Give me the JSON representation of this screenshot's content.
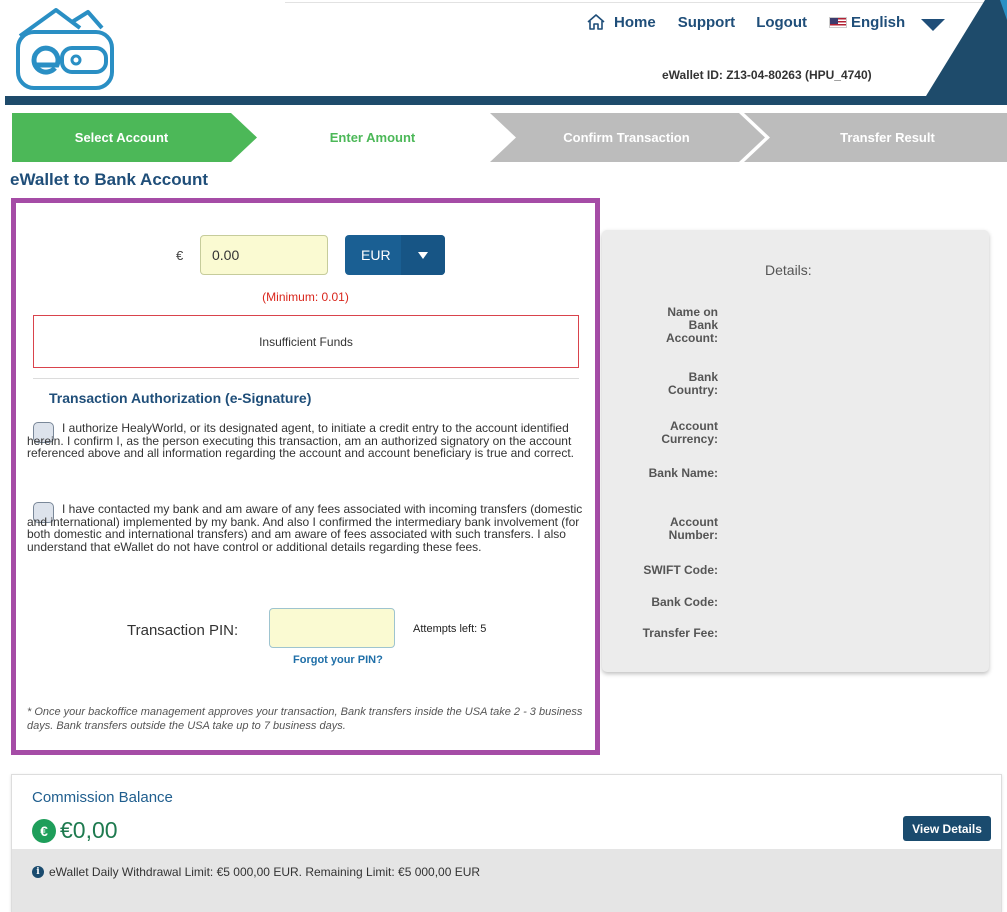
{
  "header": {
    "nav": {
      "home": "Home",
      "support": "Support",
      "logout": "Logout",
      "language": "English"
    },
    "wallet_id": "eWallet ID: Z13-04-80263 (HPU_4740)"
  },
  "steps": [
    {
      "label": "Select Account",
      "state": "complete"
    },
    {
      "label": "Enter Amount",
      "state": "current"
    },
    {
      "label": "Confirm Transaction",
      "state": "pending"
    },
    {
      "label": "Transfer Result",
      "state": "pending"
    }
  ],
  "page_title": "eWallet to Bank Account",
  "form": {
    "currency_symbol": "€",
    "amount_value": "0.00",
    "currency": "EUR",
    "minimum": "(Minimum: 0.01)",
    "error": "Insufficient Funds",
    "auth_title": "Transaction Authorization (e-Signature)",
    "consent1": "I authorize HealyWorld, or its designated agent, to initiate a credit entry to the account identified herein. I confirm I, as the person executing this transaction, am an authorized signatory on the account referenced above and all information regarding the account and account beneficiary is true and correct.",
    "consent2": "I have contacted my bank and am aware of any fees associated with incoming transfers (domestic and international) implemented by my bank. And also I confirmed the intermediary bank involvement (for both domestic and international transfers) and am aware of fees associated with such transfers. I also understand that eWallet do not have control or additional details regarding these fees.",
    "pin_label": "Transaction PIN:",
    "pin_value": "",
    "attempts": "Attempts left: 5",
    "forgot_pin": "Forgot your PIN?",
    "note": "* Once your backoffice management approves your transaction, Bank transfers inside the USA take 2 - 3 business days. Bank transfers outside the USA take up to 7 business days."
  },
  "details": {
    "title": "Details:",
    "labels": [
      "Name on Bank Account:",
      "Bank Country:",
      "Account Currency:",
      "Bank Name:",
      "Account Number:",
      "SWIFT Code:",
      "Bank Code:",
      "Transfer Fee:"
    ]
  },
  "commission": {
    "title": "Commission Balance",
    "amount": "€0,00",
    "view_details": "View Details",
    "limit_text": "eWallet Daily Withdrawal Limit: €5 000,00 EUR. Remaining Limit: €5 000,00 EUR"
  },
  "colors": {
    "brand_blue": "#1f4e79",
    "step_complete": "#4cb858",
    "step_pending": "#bcbcbc",
    "highlight_border": "#a54ca6",
    "error_red": "#d9261c"
  }
}
